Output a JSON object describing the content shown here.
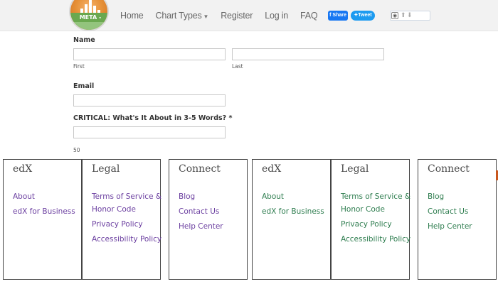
{
  "nav": {
    "logo_text": "META -",
    "items": [
      {
        "label": "Home"
      },
      {
        "label": "Chart Types"
      },
      {
        "label": "Register"
      },
      {
        "label": "Log in"
      },
      {
        "label": "FAQ"
      }
    ],
    "share_label": "Share",
    "tweet_label": "Tweet"
  },
  "form": {
    "name_label": "Name",
    "first_label": "First",
    "last_label": "Last",
    "email_label": "Email",
    "critical_label": "CRITICAL: What's It About in 3-5 Words? *",
    "char_count": "50"
  },
  "footer": {
    "columns": [
      {
        "title": "edX",
        "links": [
          "About",
          "edX for Business"
        ]
      },
      {
        "title": "Legal",
        "links": [
          "Terms of Service &",
          "Honor Code",
          "Privacy Policy",
          "Accessibility Policy"
        ]
      },
      {
        "title": "Connect",
        "links": [
          "Blog",
          "Contact Us",
          "Help Center"
        ]
      },
      {
        "title": "edX",
        "links": [
          "About",
          "edX for Business"
        ]
      },
      {
        "title": "Legal",
        "links": [
          "Terms of Service &",
          "Honor Code",
          "Privacy Policy",
          "Accessibility Policy"
        ]
      },
      {
        "title": "Connect",
        "links": [
          "Blog",
          "Contact Us",
          "Help Center"
        ]
      }
    ]
  },
  "colors": {
    "link_purple": "#6b3fa0",
    "link_green": "#2e7d4f",
    "facebook_blue": "#1877f2",
    "twitter_blue": "#1d9bf0"
  }
}
